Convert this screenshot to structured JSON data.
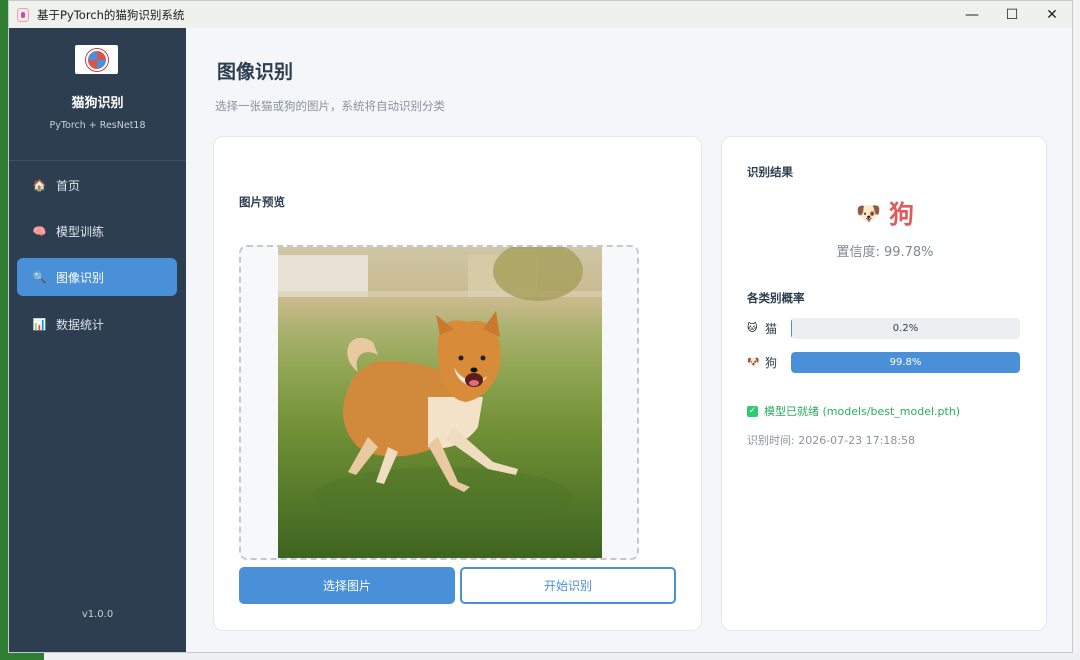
{
  "window": {
    "title": "基于PyTorch的猫狗识别系统",
    "controls": {
      "minimize": "—",
      "maximize": "☐",
      "close": "✕"
    }
  },
  "sidebar": {
    "brand": "猫狗识别",
    "subtitle": "PyTorch + ResNet18",
    "items": [
      {
        "label": "首页",
        "icon": "home-icon",
        "glyph": "🏠",
        "active": false
      },
      {
        "label": "模型训练",
        "icon": "brain-icon",
        "glyph": "🧠",
        "active": false
      },
      {
        "label": "图像识别",
        "icon": "magnifier-icon",
        "glyph": "🔍",
        "active": true
      },
      {
        "label": "数据统计",
        "icon": "bar-chart-icon",
        "glyph": "📊",
        "active": false
      }
    ],
    "version": "v1.0.0"
  },
  "main": {
    "title": "图像识别",
    "subtitle": "选择一张猫或狗的图片，系统将自动识别分类",
    "preview": {
      "label": "图片预览",
      "select_button": "选择图片",
      "start_button": "开始识别"
    },
    "result": {
      "header": "识别结果",
      "emoji": "🐶",
      "label": "狗",
      "confidence": "置信度: 99.78%",
      "probs_header": "各类别概率",
      "probs": [
        {
          "emoji": "🐱",
          "name": "猫",
          "text": "0.2%",
          "value": 0.002
        },
        {
          "emoji": "🐶",
          "name": "狗",
          "text": "99.8%",
          "value": 0.998
        }
      ],
      "model_status": "模型已就绪 (models/best_model.pth)",
      "time": "识别时间: 2026-07-23 17:18:58"
    }
  },
  "colors": {
    "accent": "#4a90d9",
    "sidebar": "#2c3e50",
    "result": "#e05b5b",
    "ok": "#27ae60"
  }
}
